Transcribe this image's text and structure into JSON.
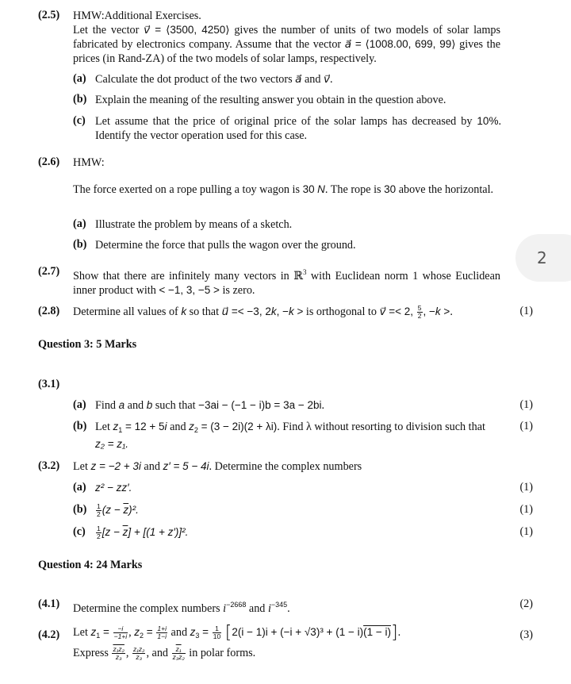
{
  "document": {
    "q2_5": {
      "number": "(2.5)",
      "title": "HMW:Additional Exercises.",
      "line1_a": "Let the vector ",
      "v_symbol": "v⃗",
      "line1_b": " = ",
      "v_value": "⟨3500, 4250⟩",
      "line1_c": " gives the number of units of two models of solar lamps fabricated by electronics company. Assume that the vector ",
      "a_symbol": "a⃗",
      "a_eq": " = ",
      "a_value": "⟨1008.00, 699, 99⟩",
      "line1_d": " gives the prices (in Rand-ZA) of the two models of solar lamps, respectively.",
      "parts": [
        {
          "label": "(a)",
          "text_a": "Calculate the dot product of the two vectors ",
          "sym1": "a⃗",
          "mid": " and ",
          "sym2": "v⃗",
          "end": "."
        },
        {
          "label": "(b)",
          "text": "Explain the meaning of the resulting answer you obtain in the question above."
        },
        {
          "label": "(c)",
          "text_a": "Let assume that the price of original price of the solar lamps has decreased by ",
          "pct": "10%",
          "text_b": ". Identify the vector operation used for this case."
        }
      ]
    },
    "q2_6": {
      "number": "(2.6)",
      "title": "HMW:",
      "text_a": "The force exerted on a rope pulling a toy wagon is ",
      "force": "30",
      "unit": "N",
      "text_b": ". The rope is ",
      "angle": "30",
      "text_c": " above the horizontal.",
      "parts": [
        {
          "label": "(a)",
          "text": "Illustrate the problem by means of a sketch."
        },
        {
          "label": "(b)",
          "text": "Determine the force that pulls the wagon over the ground."
        }
      ]
    },
    "q2_7": {
      "number": "(2.7)",
      "text_a": "Show that there are infinitely many vectors in ",
      "space": "ℝ",
      "space_exp": "3",
      "text_b": " with Euclidean norm 1 whose Euclidean inner product with ",
      "vec": "< −1, 3, −5 >",
      "text_c": " is zero."
    },
    "q2_8": {
      "number": "(2.8)",
      "text_a": "Determine all values of ",
      "k": "k",
      "text_b": " so that ",
      "u_sym": "u⃗",
      "u_val_a": " =< −3, 2",
      "u_val_b": ", −",
      "u_val_c": " >",
      "text_c": " is orthogonal to ",
      "v_sym": "v⃗",
      "v_val_a": " =< 2, ",
      "frac_n": "5",
      "frac_d": "2",
      "v_val_b": ", −",
      "v_val_c": " >",
      "end": ".",
      "marks": "(1)"
    },
    "q3": {
      "heading": "Question 3: 5 Marks",
      "q3_1": {
        "number": "(3.1)",
        "parts": [
          {
            "label": "(a)",
            "text_a": "Find ",
            "a": "a",
            "and": " and ",
            "b": "b",
            "text_b": " such that ",
            "expr": "−3ai − (−1 − i)b = 3a − 2bi",
            "end": ".",
            "marks": "(1)"
          },
          {
            "label": "(b)",
            "text_a": "Let ",
            "z1": "z",
            "z1_eq": " = 12 + 5",
            "i": "i",
            "and": " and ",
            "z2_eq": " = (3 − 2i)(2 + λi)",
            "text_b": ". Find λ without resorting to division such that",
            "line2": "z₂ = z₁.",
            "marks": "(1)"
          }
        ]
      },
      "q3_2": {
        "number": "(3.2)",
        "text_a": "Let ",
        "z_def": "z = −2 + 3i",
        "and": " and ",
        "zp_def": "z′ = 5 − 4i",
        "text_b": ". Determine the complex numbers",
        "parts": [
          {
            "label": "(a)",
            "expr": "z² − zz′.",
            "marks": "(1)"
          },
          {
            "label": "(b)",
            "frac_n": "1",
            "frac_d": "2",
            "expr_a": "(z − ",
            "zbar": "z",
            "expr_b": ")².",
            "marks": "(1)"
          },
          {
            "label": "(c)",
            "frac_n": "1",
            "frac_d": "2",
            "expr_a": "[z − ",
            "zbar": "z",
            "expr_b": "] + [(1 + z′)]².",
            "marks": "(1)"
          }
        ]
      }
    },
    "q4": {
      "heading": "Question 4: 24 Marks",
      "q4_1": {
        "number": "(4.1)",
        "text_a": "Determine the complex numbers ",
        "i": "i",
        "exp1": "−2668",
        "and": " and ",
        "exp2": "−345",
        "end": ".",
        "marks": "(2)"
      },
      "q4_2": {
        "number": "(4.2)",
        "let": "Let ",
        "z1_n": "−i",
        "z1_d": "−1+i",
        "z2_n": "1+i",
        "z2_d": "1−i",
        "and": " and ",
        "z3_n": "1",
        "z3_d": "10",
        "z3_expr_a": "2(i − 1)i + (−i + √3)³ + (1 − i)",
        "z3_expr_ov": "(1 − i)",
        "period": ".",
        "express": "Express ",
        "f1_n": "z₁z₂",
        "f1_d": "z₃",
        "f2_n": "z₁z₂",
        "f2_d": "z₃",
        "and2": ", and ",
        "f3_n": "z₁",
        "f3_d": "z₃z₂",
        "end": " in polar forms.",
        "marks": "(3)"
      }
    },
    "page_badge": "2"
  }
}
